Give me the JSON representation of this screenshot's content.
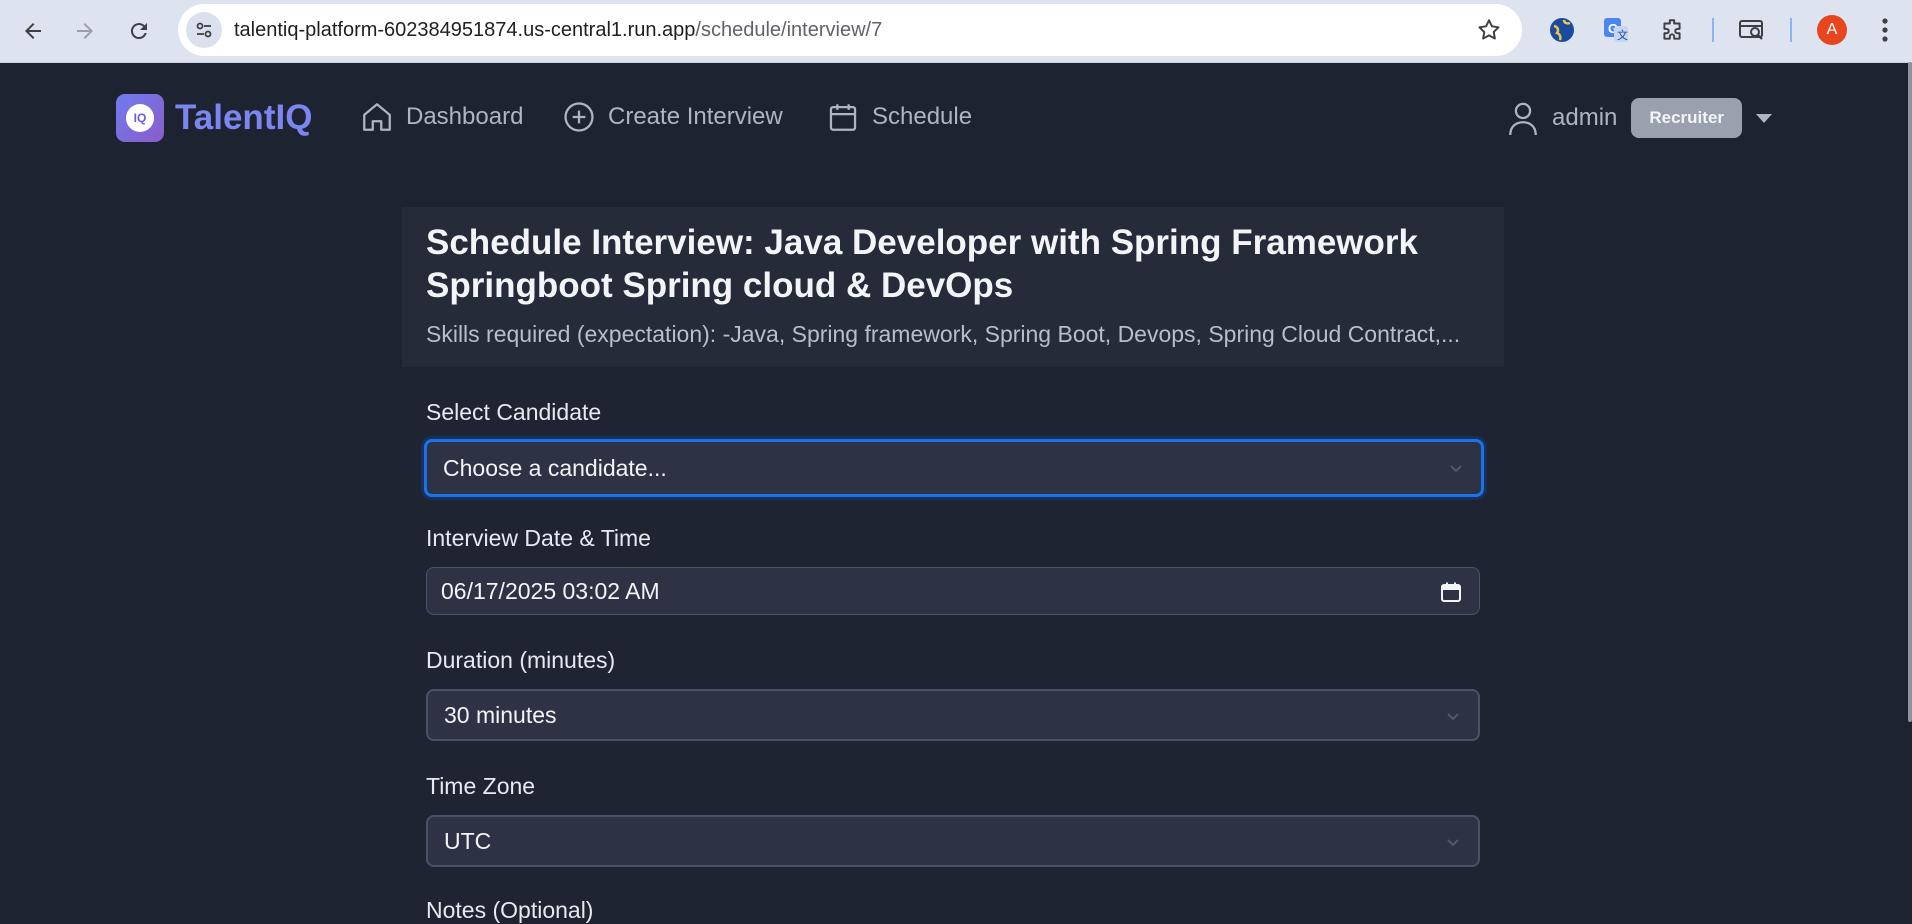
{
  "browser": {
    "url_host": "talentiq-platform-602384951874.us-central1.run.app",
    "url_path": "/schedule/interview/7",
    "profile_initial": "A"
  },
  "header": {
    "logo_text": "IQ",
    "brand": "TalentIQ",
    "nav": {
      "dashboard": "Dashboard",
      "create_interview": "Create Interview",
      "schedule": "Schedule"
    },
    "user_name": "admin",
    "role": "Recruiter"
  },
  "card": {
    "title": "Schedule Interview: Java Developer with Spring Framework Springboot Spring cloud & DevOps",
    "subtitle": "Skills required (expectation): -Java, Spring framework, Spring Boot, Devops, Spring Cloud Contract,..."
  },
  "form": {
    "candidate_label": "Select Candidate",
    "candidate_value": "Choose a candidate...",
    "datetime_label": "Interview Date & Time",
    "datetime_value": "06/17/2025 03:02  AM",
    "duration_label": "Duration (minutes)",
    "duration_value": "30 minutes",
    "timezone_label": "Time Zone",
    "timezone_value": "UTC",
    "notes_label": "Notes (Optional)"
  },
  "colors": {
    "page_bg": "#1e2332",
    "brand": "#7b86f0",
    "focus": "#1a73e8",
    "role_badge": "#9aa1ae"
  }
}
